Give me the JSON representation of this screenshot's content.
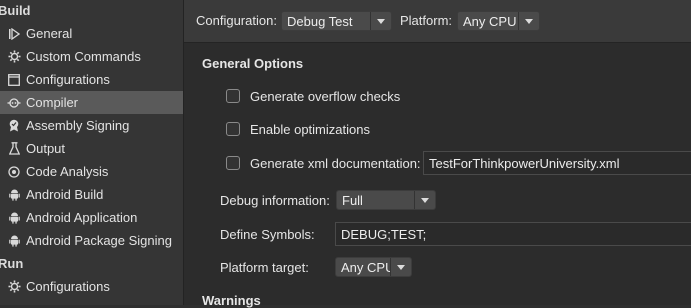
{
  "sidebar": {
    "build_header": "Build",
    "run_header": "Run",
    "items": [
      {
        "label": "General",
        "icon": "play-icon"
      },
      {
        "label": "Custom Commands",
        "icon": "gear-icon"
      },
      {
        "label": "Configurations",
        "icon": "window-icon"
      },
      {
        "label": "Compiler",
        "icon": "compiler-icon"
      },
      {
        "label": "Assembly Signing",
        "icon": "badge-icon"
      },
      {
        "label": "Output",
        "icon": "flask-icon"
      },
      {
        "label": "Code Analysis",
        "icon": "target-icon"
      },
      {
        "label": "Android Build",
        "icon": "android-icon"
      },
      {
        "label": "Android Application",
        "icon": "android-icon"
      },
      {
        "label": "Android Package Signing",
        "icon": "android-icon"
      }
    ],
    "run_items": [
      {
        "label": "Configurations",
        "icon": "gear-icon"
      }
    ]
  },
  "topbar": {
    "configuration_label": "Configuration:",
    "configuration_value": "Debug Test",
    "platform_label": "Platform:",
    "platform_value": "Any CPU"
  },
  "general_options": {
    "header": "General Options",
    "overflow_label": "Generate overflow checks",
    "optimizations_label": "Enable optimizations",
    "xmldoc_label": "Generate xml documentation:",
    "xmldoc_value": "TestForThinkpowerUniversity.xml",
    "debug_info_label": "Debug information:",
    "debug_info_value": "Full",
    "define_symbols_label": "Define Symbols:",
    "define_symbols_value": "DEBUG;TEST;",
    "platform_target_label": "Platform target:",
    "platform_target_value": "Any CPU"
  },
  "warnings": {
    "header": "Warnings"
  }
}
